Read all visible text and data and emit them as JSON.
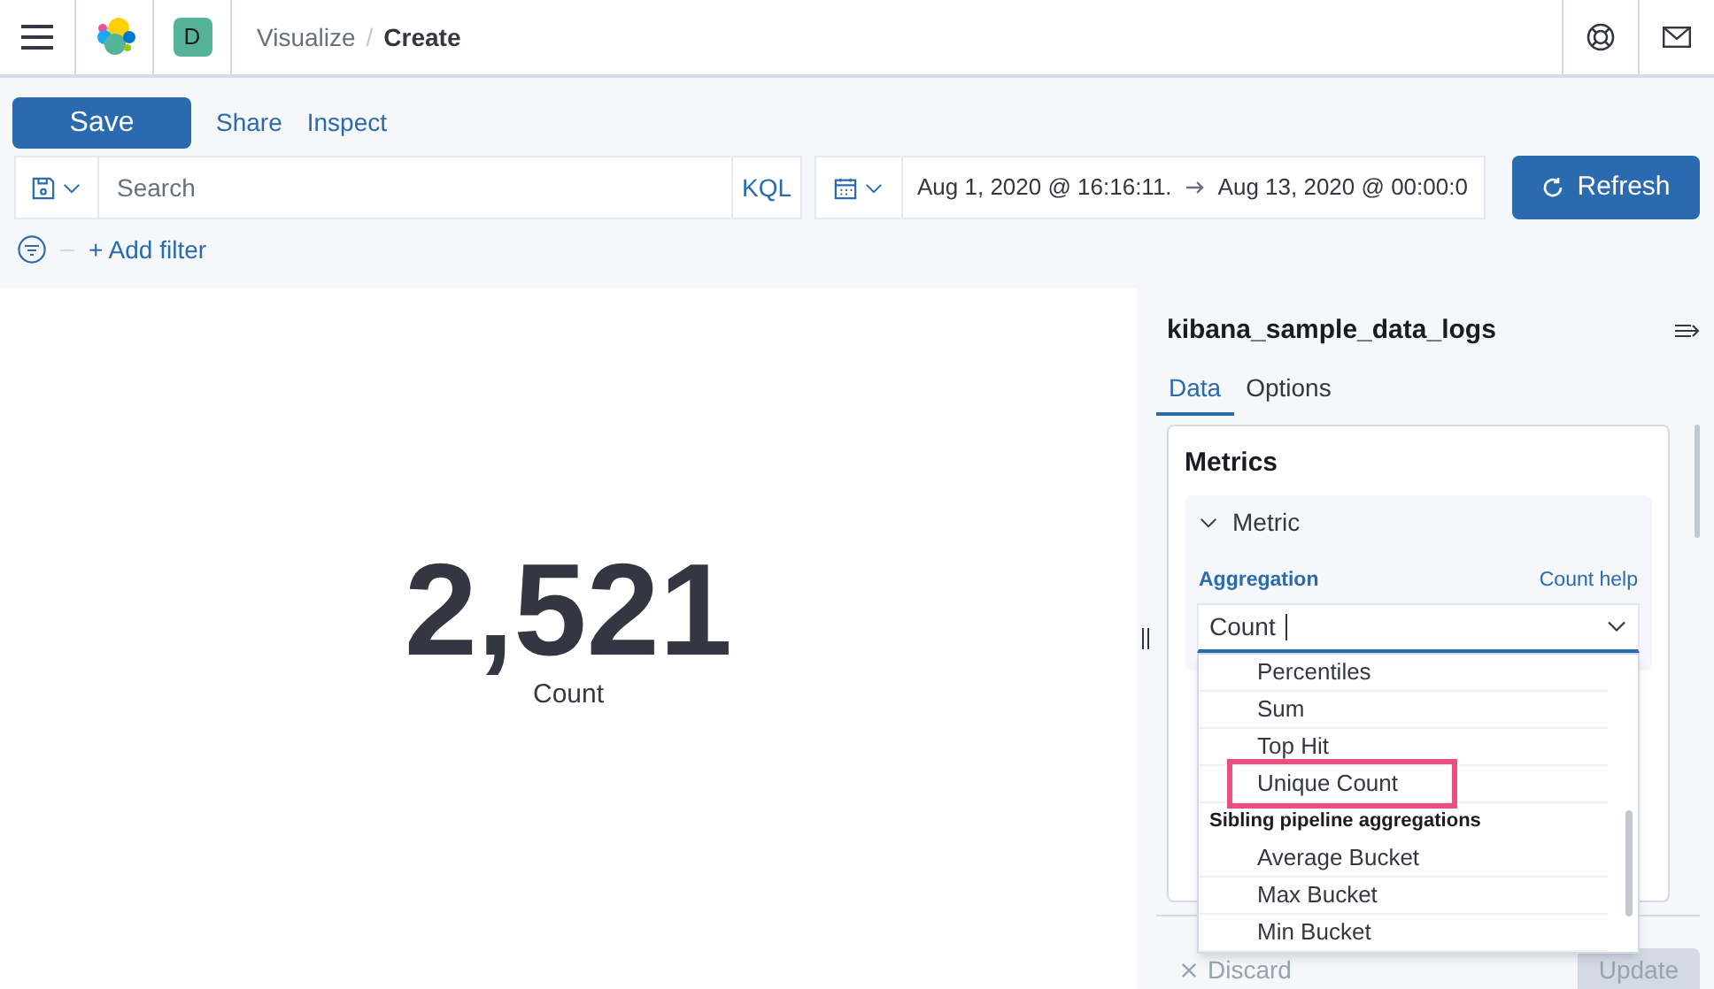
{
  "header": {
    "avatar": "D",
    "separator": "/",
    "breadcrumbs": [
      {
        "label": "Visualize",
        "current": false
      },
      {
        "label": "Create",
        "current": true
      }
    ]
  },
  "toolbar": {
    "save": "Save",
    "links": [
      "Share",
      "Inspect"
    ]
  },
  "query": {
    "placeholder": "Search",
    "language": "KQL"
  },
  "time": {
    "start": "Aug 1, 2020 @ 16:16:11.",
    "end": "Aug 13, 2020 @ 00:00:0"
  },
  "refresh": "Refresh",
  "add_filter": "+ Add filter",
  "metric": {
    "value": "2,521",
    "label": "Count"
  },
  "sidebar": {
    "title": "kibana_sample_data_logs",
    "tabs": [
      {
        "label": "Data",
        "selected": true
      },
      {
        "label": "Options",
        "selected": false
      }
    ],
    "section": "Metrics",
    "metric": {
      "title": "Metric",
      "expanded": true
    },
    "aggregation": {
      "label": "Aggregation",
      "help": "Count help",
      "value": "Count",
      "options": [
        {
          "kind": "option",
          "label": "Percentiles",
          "highlighted": false
        },
        {
          "kind": "option",
          "label": "Sum",
          "highlighted": false
        },
        {
          "kind": "option",
          "label": "Top Hit",
          "highlighted": false
        },
        {
          "kind": "option",
          "label": "Unique Count",
          "highlighted": true
        },
        {
          "kind": "group",
          "label": "Sibling pipeline aggregations"
        },
        {
          "kind": "option",
          "label": "Average Bucket",
          "highlighted": false
        },
        {
          "kind": "option",
          "label": "Max Bucket",
          "highlighted": false
        },
        {
          "kind": "option",
          "label": "Min Bucket",
          "highlighted": false
        }
      ]
    },
    "footer": {
      "discard": "Discard",
      "update": "Update"
    }
  }
}
